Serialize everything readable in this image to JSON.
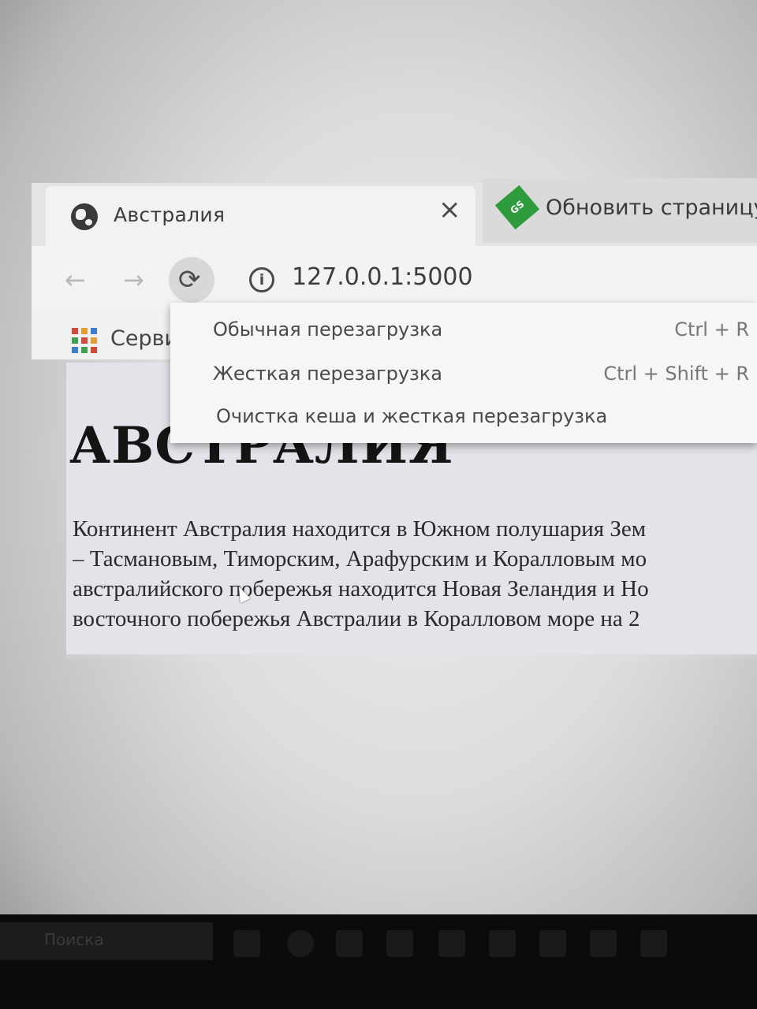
{
  "browser": {
    "tabs": [
      {
        "title": "Австралия",
        "close": "×"
      },
      {
        "title": "Обновить страницу с"
      }
    ],
    "address": "127.0.0.1:5000",
    "bookmarks_label": "Серви"
  },
  "reload_menu": {
    "items": [
      {
        "label": "Обычная перезагрузка",
        "shortcut": "Ctrl + R"
      },
      {
        "label": "Жесткая перезагрузка",
        "shortcut": "Ctrl + Shift + R"
      },
      {
        "label": "Очистка кеша и жесткая перезагрузка",
        "shortcut": ""
      }
    ]
  },
  "page": {
    "heading": "АВСТРАЛИЯ",
    "paragraph": [
      "Континент Австралия находится в Южном полушария Зем",
      "– Тасмановым, Тиморским, Арафурским и Коралловым мо",
      "австралийского побережья находится Новая Зеландия и Но",
      "восточного побережья Австралии в Коралловом море на 2"
    ]
  },
  "taskbar": {
    "search_placeholder": "Поиска"
  },
  "colors": {
    "tab2_icon": "#2e9c3c"
  }
}
